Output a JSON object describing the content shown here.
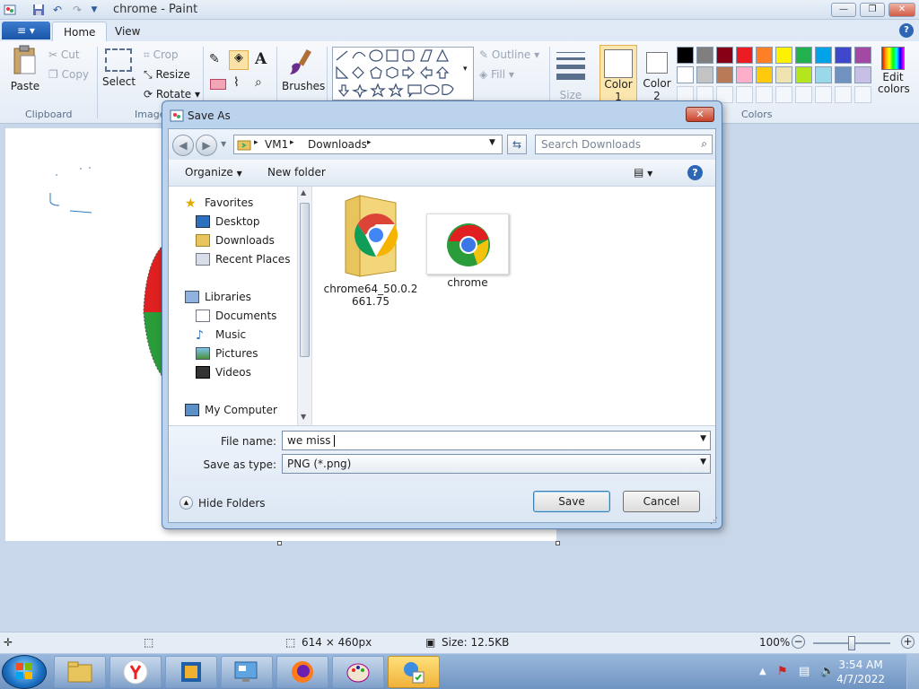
{
  "paint": {
    "title": "chrome - Paint",
    "menu": {
      "file_symbol": "≡",
      "tabs": [
        "Home",
        "View"
      ],
      "help": "?"
    },
    "ribbon": {
      "clipboard": {
        "paste": "Paste",
        "cut": "Cut",
        "copy": "Copy",
        "label": "Clipboard"
      },
      "image": {
        "select": "Select",
        "crop": "Crop",
        "resize": "Resize",
        "rotate": "Rotate",
        "label": "Image"
      },
      "tools": {
        "brushes": "Brushes"
      },
      "shapes": {
        "outline": "Outline",
        "fill": "Fill"
      },
      "size": "Size",
      "color1": [
        "Color",
        "1"
      ],
      "color2": [
        "Color",
        "2"
      ],
      "colors_label": "Colors",
      "edit_colors": [
        "Edit",
        "colors"
      ],
      "palette_row1": [
        "#000000",
        "#7f7f7f",
        "#880015",
        "#ed1c24",
        "#ff7f27",
        "#fff200",
        "#22b14c",
        "#00a2e8",
        "#3f48cc",
        "#a349a4"
      ],
      "palette_row2": [
        "#ffffff",
        "#c3c3c3",
        "#b97a57",
        "#ffaec9",
        "#ffc90e",
        "#efe4b0",
        "#b5e61d",
        "#99d9ea",
        "#7092be",
        "#c8bfe7"
      ]
    },
    "status": {
      "dimensions": "614 × 460px",
      "size": "Size: 12.5KB",
      "zoom": "100%",
      "zoom_level": 0.5
    }
  },
  "dialog": {
    "title": "Save As",
    "close": "✕",
    "address": {
      "parts": [
        "VM1",
        "Downloads"
      ]
    },
    "search_placeholder": "Search Downloads",
    "toolbar": {
      "organize": "Organize",
      "new_folder": "New folder"
    },
    "nav": {
      "favorites": "Favorites",
      "favorites_items": [
        "Desktop",
        "Downloads",
        "Recent Places"
      ],
      "libraries": "Libraries",
      "libraries_items": [
        "Documents",
        "Music",
        "Pictures",
        "Videos"
      ],
      "computer": "My Computer"
    },
    "files": [
      {
        "name": "chrome64_50.0.2661.75",
        "line1": "chrome64_50.0.2",
        "line2": "661.75"
      },
      {
        "name": "chrome",
        "line1": "chrome",
        "line2": ""
      }
    ],
    "file_name_label": "File name:",
    "file_name_value": "we miss ",
    "save_type_label": "Save as type:",
    "save_type_value": "PNG (*.png)",
    "hide_folders": "Hide Folders",
    "save": "Save",
    "cancel": "Cancel"
  },
  "taskbar": {
    "time": "3:54 AM",
    "date": "4/7/2022"
  }
}
